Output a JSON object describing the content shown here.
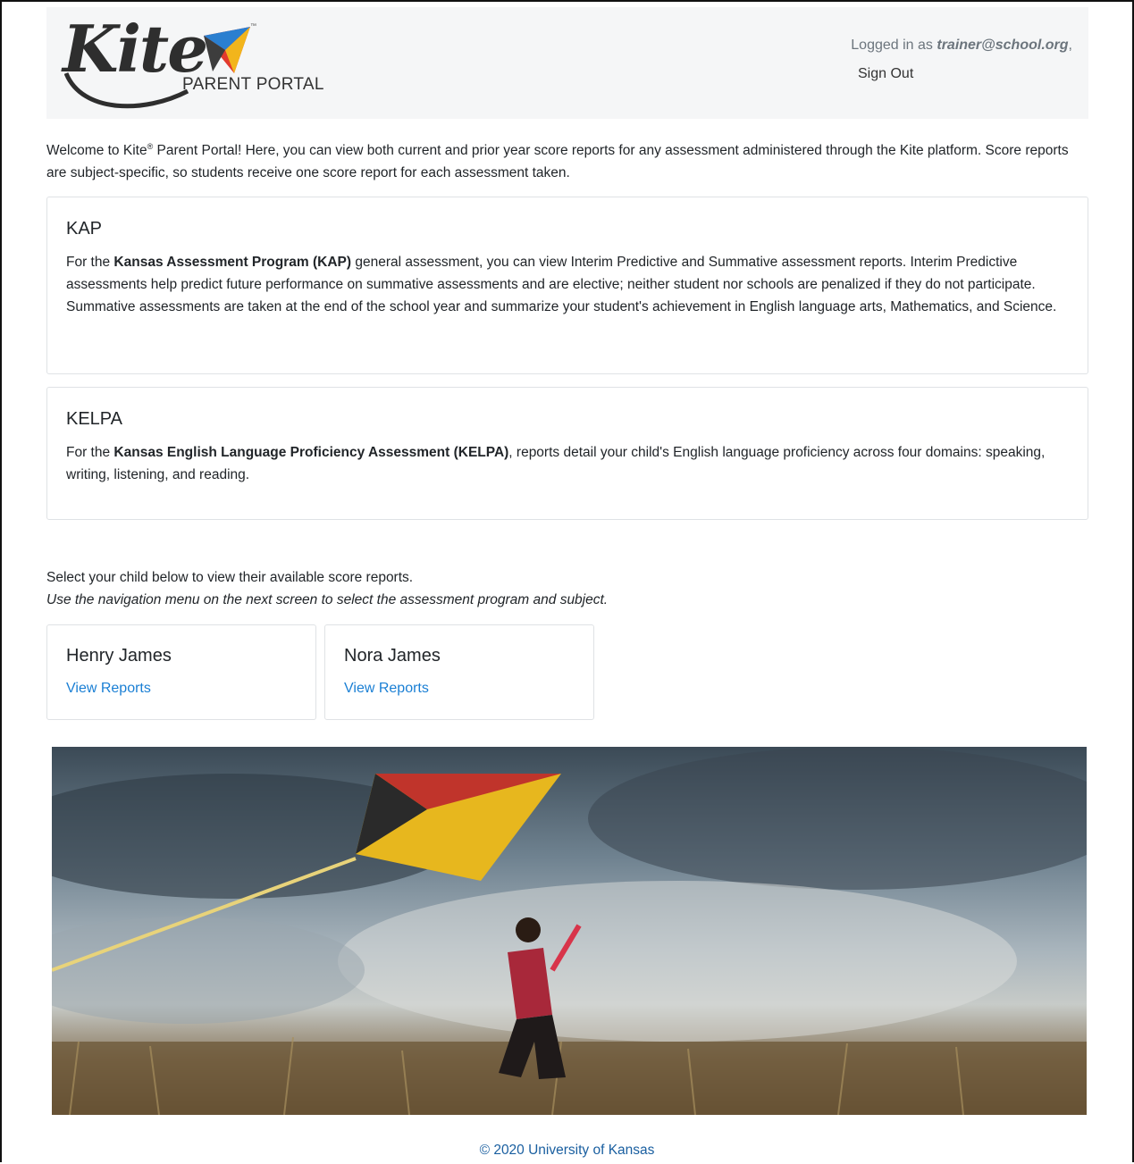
{
  "header": {
    "logo_word": "Kite",
    "logo_sub": "PARENT PORTAL",
    "logo_tm": "™",
    "logged_in_prefix": "Logged in as ",
    "user_email": "trainer@school.org",
    "logged_in_suffix": ",",
    "sign_out": "Sign Out"
  },
  "intro": {
    "part1": "Welcome to Kite",
    "reg": "®",
    "part2": " Parent Portal! Here, you can view both current and prior year score reports for any assessment administered through the Kite platform. Score reports are subject-specific, so students receive one score report for each assessment taken."
  },
  "kap": {
    "title": "KAP",
    "pre": "For the ",
    "bold": "Kansas Assessment Program (KAP)",
    "post": " general assessment, you can view Interim Predictive and Summative assessment reports. Interim Predictive assessments help predict future performance on summative assessments and are elective; neither student nor schools are penalized if they do not participate. Summative assessments are taken at the end of the school year and summarize your student's achievement in English language arts, Mathematics, and Science."
  },
  "kelpa": {
    "title": "KELPA",
    "pre": "For the ",
    "bold": "Kansas English Language Proficiency Assessment (KELPA)",
    "post": ", reports detail your child's English language proficiency across four domains: speaking, writing, listening, and reading."
  },
  "select": {
    "line1": "Select your child below to view their available score reports.",
    "line2": "Use the navigation menu on the next screen to select the assessment program and subject."
  },
  "children": [
    {
      "name": "Henry James",
      "link": "View Reports"
    },
    {
      "name": "Nora James",
      "link": "View Reports"
    }
  ],
  "footer": {
    "text": "© 2020 University of Kansas"
  },
  "colors": {
    "link": "#1a7fd4",
    "header_bg": "#f5f6f7",
    "card_border": "#dfe2e5"
  }
}
